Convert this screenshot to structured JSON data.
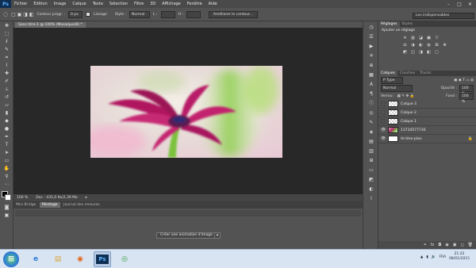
{
  "app": {
    "logo": "Ps",
    "menu": [
      "Fichier",
      "Edition",
      "Image",
      "Calque",
      "Texte",
      "Sélection",
      "Filtre",
      "3D",
      "Affichage",
      "Fenêtre",
      "Aide"
    ],
    "window_controls": [
      "–",
      "□",
      "✕"
    ]
  },
  "options_bar": {
    "contour_label": "Contour progr. :",
    "contour_value": "0 px",
    "lissage_label": "Lissage",
    "style_label": "Style :",
    "style_value": "Normal",
    "l_label": "L :",
    "h_label": "H :",
    "refine_button": "Améliorer le contour...",
    "workspace": "Les indispensables"
  },
  "document": {
    "tab_title": "Sans titre-1 @ 100% (Mosaïque/8) *",
    "zoom": "100 %",
    "doc_info": "Doc : 435,0 Ko/2,39 Mo"
  },
  "timeline": {
    "tabs": [
      "Mini Bridge",
      "Montage",
      "Journal des mesures"
    ],
    "active_tab": 1,
    "create_button": "Créer une animation d'image"
  },
  "adjustments_panel": {
    "tabs": [
      "Réglages",
      "Styles"
    ],
    "title": "Ajouter un réglage",
    "row1": [
      "☀",
      "▥",
      "◪",
      "▣",
      "▽"
    ],
    "row2": [
      "⚖",
      "◑",
      "◐",
      "◍",
      "⊞",
      "⊕"
    ],
    "row3": [
      "◩",
      "◫",
      "◨",
      "◧",
      "▢"
    ]
  },
  "layers_panel": {
    "tabs": [
      "Calques",
      "Couches",
      "Tracés"
    ],
    "filter": "P Type",
    "blend_mode": "Normal",
    "opacity_label": "Opacité :",
    "opacity_value": "100 %",
    "lock_label": "Verrou :",
    "fill_label": "Fond :",
    "fill_value": "100 %",
    "layers": [
      {
        "name": "Calque 3",
        "thumb": "checker",
        "visible": false
      },
      {
        "name": "Calque 2",
        "thumb": "checker",
        "visible": false
      },
      {
        "name": "Calque 1",
        "thumb": "checker",
        "visible": false
      },
      {
        "name": "13734577730",
        "thumb": "photo",
        "visible": true
      },
      {
        "name": "Arrière-plan",
        "thumb": "white",
        "visible": true,
        "locked": true
      }
    ],
    "footer_icons": [
      "⚭",
      "fx",
      "◘",
      "◉",
      "▣",
      "◻",
      "🗑"
    ]
  },
  "taskbar": {
    "apps": [
      {
        "name": "Internet Explorer",
        "glyph": "e",
        "color": "#2a7fd4"
      },
      {
        "name": "Explorateur",
        "glyph": "▤",
        "color": "#d8a93c"
      },
      {
        "name": "Firefox",
        "glyph": "◉",
        "color": "#e0661c"
      },
      {
        "name": "Photoshop",
        "glyph": "Ps",
        "color": "#0f2f52"
      },
      {
        "name": "Chrome",
        "glyph": "◎",
        "color": "#3aa047"
      }
    ],
    "lang": "FRA",
    "time": "21:22",
    "date": "08/01/2015"
  },
  "colors": {
    "accent_pink": "#b0195f",
    "panel": "#535353",
    "canvas_bg": "#282828"
  }
}
